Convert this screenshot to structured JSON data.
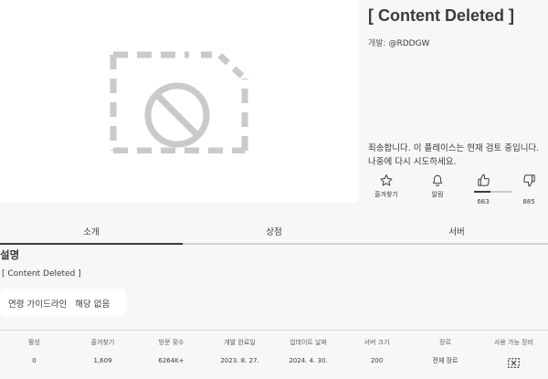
{
  "place": {
    "title": "[ Content Deleted ]",
    "creator_label": "개발: ",
    "creator_handle": "@RDDGW",
    "notice": "죄송합니다. 이 플레이스는 현재 검토 중입니다. 나중에 다시 시도하세요."
  },
  "actions": {
    "favorite": {
      "label": "즐겨찾기",
      "icon": "star-icon"
    },
    "notify": {
      "label": "알림",
      "icon": "bell-icon"
    },
    "upvote": {
      "count": "663",
      "icon": "thumbs-up-icon"
    },
    "downvote": {
      "count": "885",
      "icon": "thumbs-down-icon"
    },
    "vote_ratio": 0.43
  },
  "tabs": [
    "소개",
    "상점",
    "서버"
  ],
  "active_tab": 0,
  "about": {
    "heading": "설명",
    "description": "[ Content Deleted ]",
    "age_guideline_label": "연령 가이드라인",
    "age_guideline_value": "해당 없음"
  },
  "stats": [
    {
      "label": "활성",
      "value": "0"
    },
    {
      "label": "즐겨찾기",
      "value": "1,609"
    },
    {
      "label": "방문 횟수",
      "value": "6264K+"
    },
    {
      "label": "개발 완료일",
      "value": "2023. 8. 27."
    },
    {
      "label": "업데이트 날짜",
      "value": "2024. 4. 30."
    },
    {
      "label": "서버 크기",
      "value": "200"
    },
    {
      "label": "장르",
      "value": "전체 장르"
    },
    {
      "label": "사용 가능 장비",
      "value": "",
      "icon": "unavailable-device-icon"
    }
  ],
  "colors": {
    "text": "#393b3d",
    "background": "#f7f7f8",
    "thumbnail_bg": "#ffffff",
    "placeholder_icon": "#c9cacc"
  }
}
